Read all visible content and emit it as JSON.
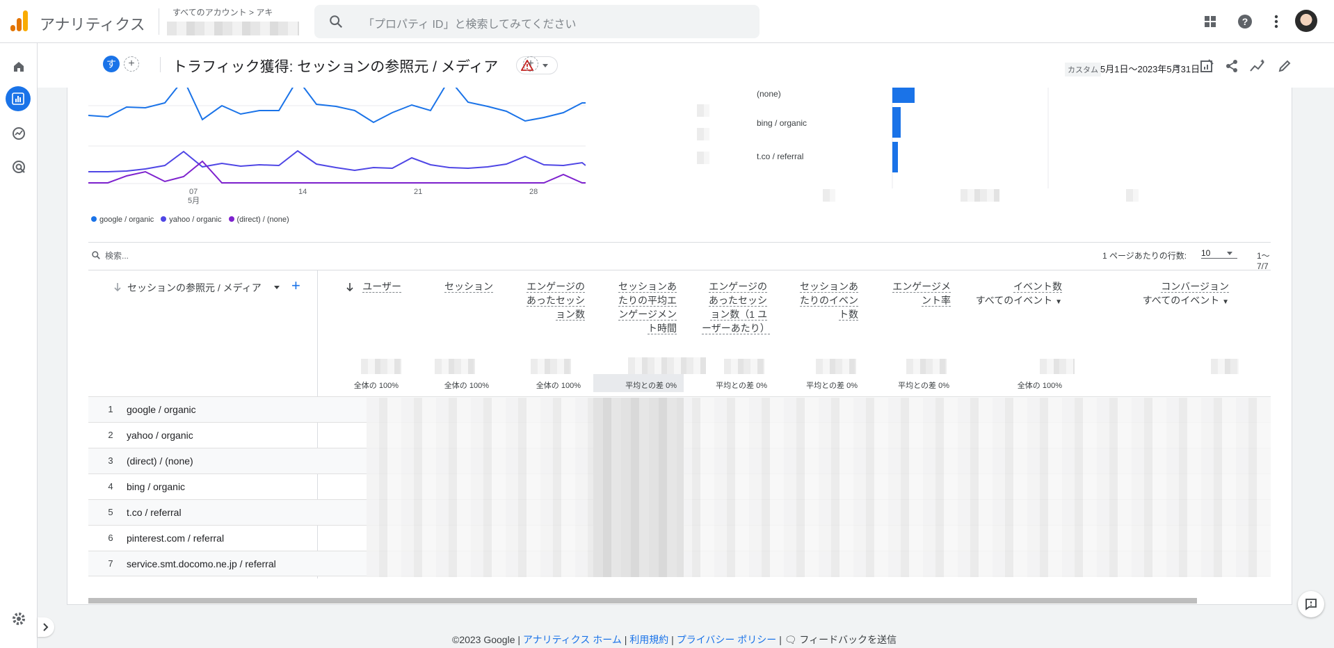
{
  "app": {
    "title": "アナリティクス",
    "breadcrumb": "すべてのアカウント > アキ"
  },
  "search": {
    "placeholder": "「プロパティ ID」と検索してみてください"
  },
  "report": {
    "chip": "す",
    "title": "トラフィック獲得: セッションの参照元 / メディア",
    "date_label": "カスタム",
    "date_value": "5月1日～2023年5月31日"
  },
  "chart": {
    "x_ticks": [
      "07",
      "14",
      "21",
      "28"
    ],
    "x_month": "5月",
    "legend": [
      "google / organic",
      "yahoo / organic",
      "(direct) / (none)"
    ],
    "bar_labels": [
      "(none)",
      "bing / organic",
      "t.co / referral"
    ]
  },
  "table": {
    "search_placeholder": "検索...",
    "rows_label": "1 ページあたりの行数:",
    "rows_value": "10",
    "pager": "1～7/7",
    "dim_header": "セッションの参照元 / メディア",
    "columns": [
      {
        "label": "ユーザー",
        "total": "全体の 100%"
      },
      {
        "label": "セッション",
        "total": "全体の 100%"
      },
      {
        "label": "エンゲージのあったセッション数",
        "total": "全体の 100%"
      },
      {
        "label": "セッションあたりの平均エンゲージメント時間",
        "total": "平均との差 0%"
      },
      {
        "label": "エンゲージのあったセッション数（1 ユーザーあたり）",
        "total": "平均との差 0%"
      },
      {
        "label": "セッションあたりのイベント数",
        "total": "平均との差 0%"
      },
      {
        "label": "エンゲージメント率",
        "total": "平均との差 0%"
      },
      {
        "label": "イベント数",
        "sub": "すべてのイベント",
        "total": "全体の 100%"
      },
      {
        "label": "コンバージョン",
        "sub": "すべてのイベント",
        "total": ""
      }
    ],
    "rows": [
      {
        "n": "1",
        "d": "google / organic"
      },
      {
        "n": "2",
        "d": "yahoo / organic"
      },
      {
        "n": "3",
        "d": "(direct) / (none)"
      },
      {
        "n": "4",
        "d": "bing / organic"
      },
      {
        "n": "5",
        "d": "t.co / referral"
      },
      {
        "n": "6",
        "d": "pinterest.com / referral"
      },
      {
        "n": "7",
        "d": "service.smt.docomo.ne.jp / referral"
      }
    ]
  },
  "footer": {
    "copyright": "©2023 Google |",
    "links": [
      "アナリティクス ホーム",
      "利用規約",
      "プライバシー ポリシー"
    ],
    "feedback": "フィードバックを送信"
  },
  "colors": {
    "accent": "#1a73e8",
    "series1": "#1a73e8",
    "series2": "#4f46e5",
    "series3": "#7e22ce"
  }
}
